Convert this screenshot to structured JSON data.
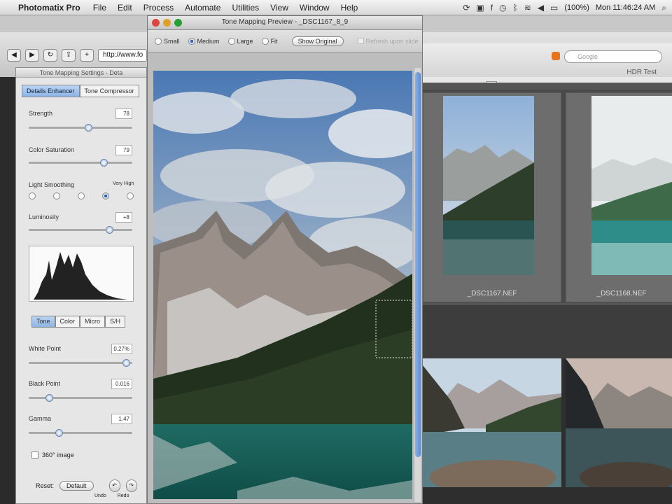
{
  "menubar": {
    "app_name": "Photomatix Pro",
    "items": [
      "File",
      "Edit",
      "Process",
      "Automate",
      "Utilities",
      "View",
      "Window",
      "Help"
    ],
    "clock": "Mon 11:46:24 AM",
    "status_text": "(100%)"
  },
  "browser": {
    "url": "http://www.fo",
    "search_placeholder": "Google",
    "bookmark": "HDR Test"
  },
  "settings_panel": {
    "title": "Tone Mapping Settings - Deta",
    "tabs": [
      "Details Enhancer",
      "Tone Compressor"
    ],
    "strength_label": "Strength",
    "strength_value": "78",
    "color_saturation_label": "Color Saturation",
    "color_saturation_value": "79",
    "light_smoothing_label": "Light Smoothing",
    "light_smoothing_high_label": "Very High",
    "luminosity_label": "Luminosity",
    "luminosity_value": "+8",
    "tone_tabs": [
      "Tone",
      "Color",
      "Micro",
      "S/H"
    ],
    "white_point_label": "White Point",
    "white_point_value": "0.27%",
    "black_point_label": "Black Point",
    "black_point_value": "0.016",
    "gamma_label": "Gamma",
    "gamma_value": "1.47",
    "image_360_label": "360° image",
    "reset_label": "Reset:",
    "default_button": "Default",
    "undo_label": "Undo",
    "redo_label": "Redo"
  },
  "preview": {
    "title": "Tone Mapping Preview - _DSC1167_8_9",
    "sizes": [
      "Small",
      "Medium",
      "Large",
      "Fit"
    ],
    "selected_size": "Medium",
    "show_original": "Show Original",
    "refresh_label": "Refresh upon slide"
  },
  "thumbnails": [
    {
      "label": "_DSC1167.NEF"
    },
    {
      "label": "_DSC1168.NEF"
    }
  ]
}
